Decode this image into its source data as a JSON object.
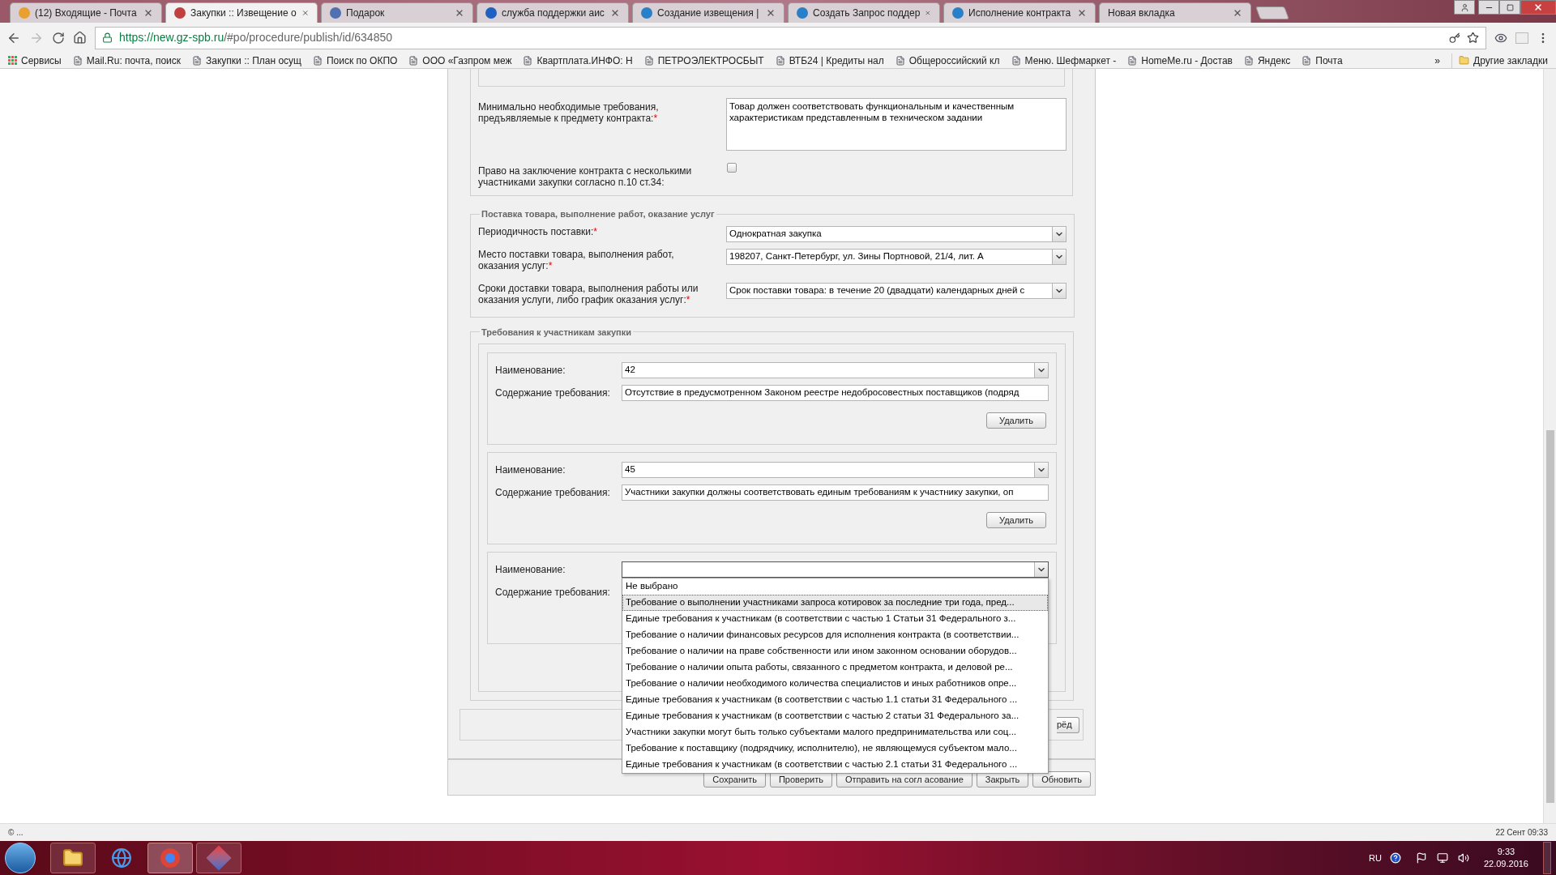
{
  "browser": {
    "tabs": [
      {
        "title": "(12) Входящие - Почта",
        "selected": false
      },
      {
        "title": "Закупки :: Извещение о",
        "selected": true
      },
      {
        "title": "Подарок",
        "selected": false
      },
      {
        "title": "служба поддержки аис",
        "selected": false
      },
      {
        "title": "Создание извещения |",
        "selected": false
      },
      {
        "title": "Создать Запрос поддер",
        "selected": false
      },
      {
        "title": "Исполнение контракта",
        "selected": false
      },
      {
        "title": "Новая вкладка",
        "selected": false
      }
    ],
    "url_host": "https://new.gz-spb.ru",
    "url_path": "/#po/procedure/publish/id/634850",
    "bookmarks": [
      {
        "label": "Сервисы"
      },
      {
        "label": "Mail.Ru: почта, поиск"
      },
      {
        "label": "Закупки :: План осущ"
      },
      {
        "label": "Поиск по ОКПО"
      },
      {
        "label": "ООО «Газпром меж"
      },
      {
        "label": "Квартплата.ИНФО: Н"
      },
      {
        "label": "ПЕТРОЭЛЕКТРОСБЫТ"
      },
      {
        "label": "ВТБ24 | Кредиты нал"
      },
      {
        "label": "Общероссийский кл"
      },
      {
        "label": "Меню. Шефмаркет -"
      },
      {
        "label": "HomeMe.ru - Достав"
      },
      {
        "label": "Яндекс"
      },
      {
        "label": "Почта"
      }
    ],
    "more": "»",
    "other_bookmarks": "Другие закладки"
  },
  "form": {
    "contract_rows": [
      {
        "kind": "textarea",
        "label": "Минимально необходимые требования, предъявляемые к предмету контракта:",
        "mark": "*",
        "value": "Товар должен соответствовать функциональным и качественным характеристикам представленным в техническом задании"
      },
      {
        "kind": "checkbox",
        "label": "Право на заключение контракта с несколькими участниками закупки согласно п.10 ст.34:",
        "checked": false
      }
    ],
    "delivery": {
      "legend": "Поставка товара, выполнение работ, оказание услуг",
      "rows": [
        {
          "label": "Периодичность поставки:",
          "mark": "*",
          "value": "Однократная закупка"
        },
        {
          "label": "Место поставки товара, выполнения работ, оказания услуг:",
          "mark": "*",
          "value": "198207, Санкт-Петербург, ул. Зины Портновой, 21/4, лит. А"
        },
        {
          "label": "Сроки доставки товара, выполнения работы или оказания услуги, либо график оказания услуг:",
          "mark": "*",
          "value": "Срок поставки товара: в течение 20 (двадцати) календарных дней с"
        }
      ]
    },
    "requirements": {
      "legend": "Требования к участникам закупки",
      "items": [
        {
          "name_label": "Наименование:",
          "name_value": "42",
          "content_label": "Содержание требования:",
          "content_value": "Отсутствие в предусмотренном Законом реестре недобросовестных поставщиков (подряд",
          "delete": "Удалить",
          "open": false
        },
        {
          "name_label": "Наименование:",
          "name_value": "45",
          "content_label": "Содержание требования:",
          "content_value": "Участники закупки должны соответствовать единым требованиям к участнику закупки, оп",
          "delete": "Удалить",
          "open": false
        },
        {
          "name_label": "Наименование:",
          "content_label": "Содержание требования:",
          "open": true
        }
      ],
      "options": [
        {
          "label": "Не выбрано",
          "selected": false
        },
        {
          "label": "Требование о выполнении участниками запроса котировок за последние три года, пред...",
          "selected": true
        },
        {
          "label": "Единые требования к участникам (в соответствии с частью 1 Статьи 31 Федерального з...",
          "selected": false
        },
        {
          "label": "Требование о наличии финансовых ресурсов для исполнения контракта (в соответствии...",
          "selected": false
        },
        {
          "label": "Требование о наличии на праве собственности или ином законном основании оборудов...",
          "selected": false
        },
        {
          "label": "Требование о наличии опыта работы, связанного с предметом контракта, и деловой ре...",
          "selected": false
        },
        {
          "label": "Требование о наличии необходимого количества специалистов и иных работников опре...",
          "selected": false
        },
        {
          "label": "Единые требования к участникам (в соответствии с частью 1.1 статьи 31 Федерального ...",
          "selected": false
        },
        {
          "label": "Единые требования к участникам (в соответствии с частью 2 статьи 31 Федерального за...",
          "selected": false
        },
        {
          "label": "Участники закупки могут быть только субъектами малого предпринимательства или соц...",
          "selected": false
        },
        {
          "label": "Требование к поставщику (подрядчику, исполнителю), не являющемуся субъектом мало...",
          "selected": false
        },
        {
          "label": "Единые требования к участникам (в соответствии с частью 2.1 статьи 31 Федерального ...",
          "selected": false
        }
      ]
    },
    "partial_button": "рёд",
    "buttons": [
      "Сохранить",
      "Проверить",
      "Отправить на согл асование",
      "Закрыть",
      "Обновить"
    ]
  },
  "status_bar": {
    "left": "© ...",
    "right": "22 Сент 09:33"
  },
  "taskbar": {
    "language": "RU",
    "time": "9:33",
    "date": "22.09.2016"
  }
}
